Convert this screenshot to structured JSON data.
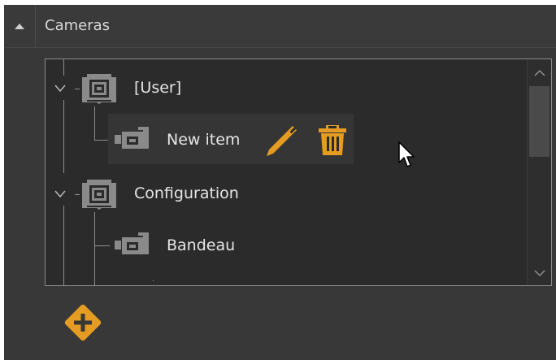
{
  "panel": {
    "title": "Cameras",
    "collapse_icon": "caret-up-icon"
  },
  "tree": {
    "groups": [
      {
        "label": "[User]",
        "icon": "camera-folder-icon",
        "expander": "chevron-down-icon",
        "children": [
          {
            "label": "New item",
            "icon": "camera-icon",
            "actions": [
              "pencil-icon",
              "trash-icon"
            ]
          }
        ]
      },
      {
        "label": "Configuration",
        "icon": "camera-folder-icon",
        "expander": "chevron-down-icon",
        "children": [
          {
            "label": "Bandeau",
            "icon": "camera-icon"
          }
        ]
      }
    ]
  },
  "footer": {
    "add_icon": "add-circle-icon"
  },
  "colors": {
    "panel_bg": "#383838",
    "tree_bg": "#2b2b2b",
    "accent": "#e59c22",
    "text": "#e6e6e6",
    "icon_gray": "#8a8a8a"
  }
}
